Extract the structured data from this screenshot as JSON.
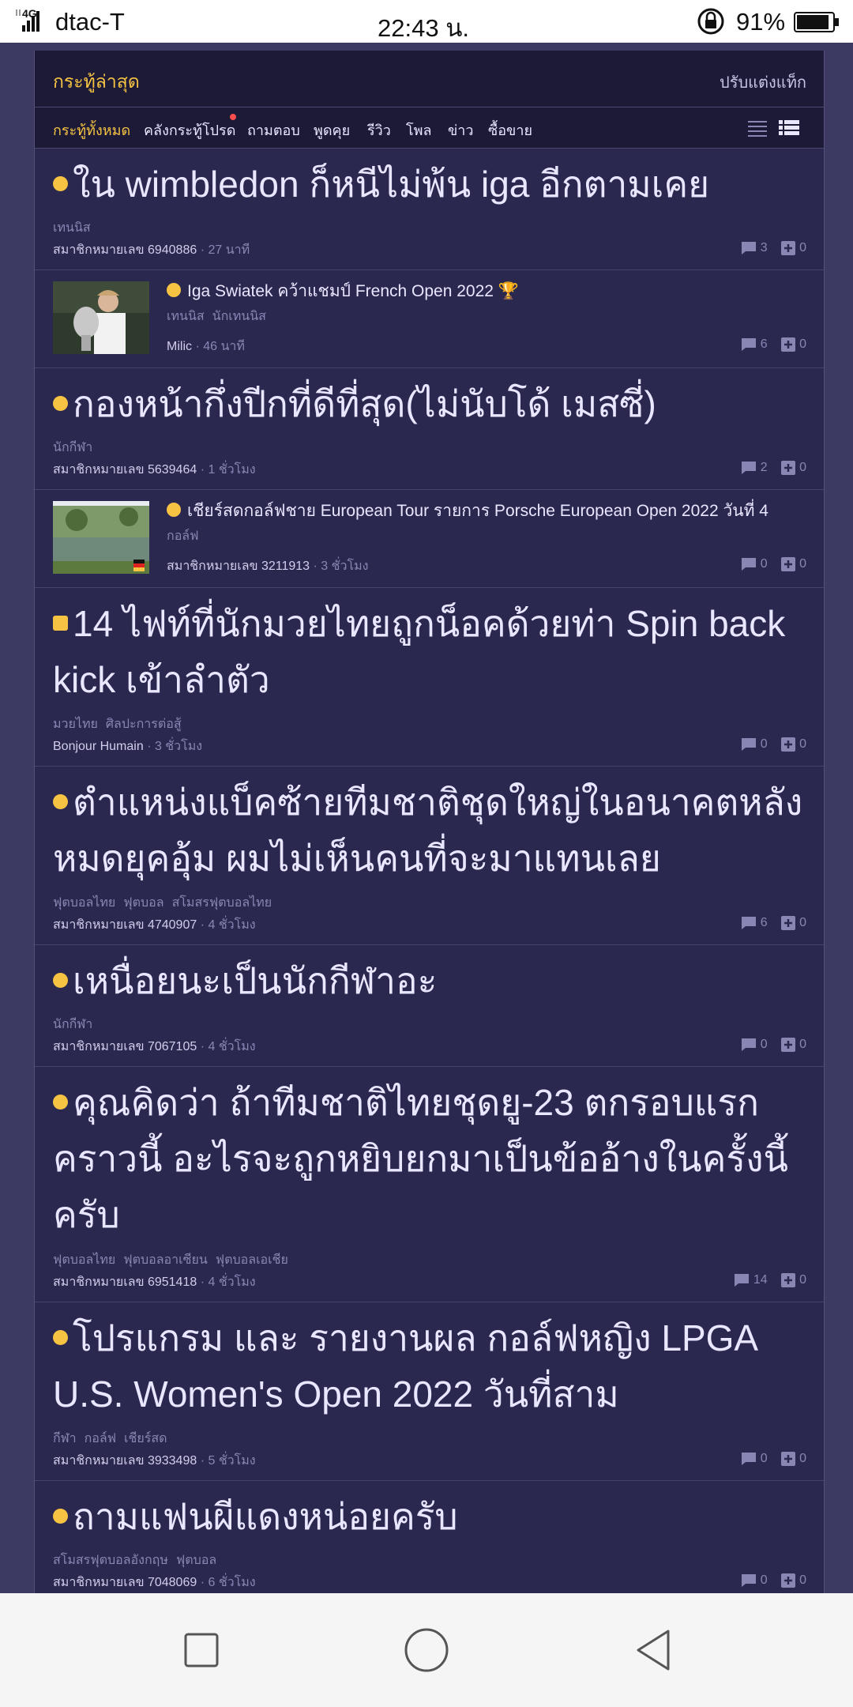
{
  "status": {
    "network": "4G",
    "carrier": "dtac-T",
    "time": "22:43 น.",
    "battery": "91%",
    "battery_level": 0.91
  },
  "header": {
    "title": "กระทู้ล่าสุด",
    "customize": "ปรับแต่งแท็ก"
  },
  "tabs": [
    {
      "label": "กระทู้ทั้งหมด"
    },
    {
      "label": "คลังกระทู้โปรด"
    },
    {
      "label": "ถามตอบ"
    },
    {
      "label": "พูดคุย"
    },
    {
      "label": "รีวิว"
    },
    {
      "label": "โพล"
    },
    {
      "label": "ข่าว"
    },
    {
      "label": "ซื้อขาย"
    }
  ],
  "topics": [
    {
      "title": "ใน wimbledon ก็หนีไม่พ้น iga อีกตามเคย",
      "tags": [
        "เทนนิส"
      ],
      "author": "สมาชิกหมายเลข 6940886",
      "time": "· 27 นาที",
      "comments": "3",
      "votes": "0"
    },
    {
      "title": "Iga Swiatek คว้าแชมป์ French Open 2022 🏆",
      "tags": [
        "เทนนิส",
        "นักเทนนิส"
      ],
      "author": "Milic",
      "time": "· 46 นาที",
      "comments": "6",
      "votes": "0"
    },
    {
      "title": "กองหน้ากึ่งปีกที่ดีที่สุด(ไม่นับโด้ เมสซี่)",
      "tags": [
        "นักกีฬา"
      ],
      "author": "สมาชิกหมายเลข 5639464",
      "time": "· 1 ชั่วโมง",
      "comments": "2",
      "votes": "0"
    },
    {
      "title": "เชียร์สดกอล์ฟชาย European Tour รายการ Porsche European Open 2022 วันที่ 4",
      "tags": [
        "กอล์ฟ"
      ],
      "author": "สมาชิกหมายเลข 3211913",
      "time": "· 3 ชั่วโมง",
      "comments": "0",
      "votes": "0"
    },
    {
      "title": "14 ไฟท์ที่นักมวยไทยถูกน็อคด้วยท่า Spin back kick เข้าลำตัว",
      "tags": [
        "มวยไทย",
        "ศิลปะการต่อสู้"
      ],
      "author": "Bonjour Humain",
      "time": "· 3 ชั่วโมง",
      "comments": "0",
      "votes": "0"
    },
    {
      "title": "ตำแหน่งแบ็คซ้ายทีมชาติชุดใหญ่ในอนาคตหลังหมดยุคอุ้ม ผมไม่เห็นคนที่จะมาแทนเลย",
      "tags": [
        "ฟุตบอลไทย",
        "ฟุตบอล",
        "สโมสรฟุตบอลไทย"
      ],
      "author": "สมาชิกหมายเลข 4740907",
      "time": "· 4 ชั่วโมง",
      "comments": "6",
      "votes": "0"
    },
    {
      "title": "เหนื่อยนะเป็นนักกีฬาอะ",
      "tags": [
        "นักกีฬา"
      ],
      "author": "สมาชิกหมายเลข 7067105",
      "time": "· 4 ชั่วโมง",
      "comments": "0",
      "votes": "0"
    },
    {
      "title": "คุณคิดว่า ถ้าทีมชาติไทยชุดยู-23 ตกรอบแรกคราวนี้ อะไรจะถูกหยิบยกมาเป็นข้ออ้างในครั้งนี้ครับ",
      "tags": [
        "ฟุตบอลไทย",
        "ฟุตบอลอาเซียน",
        "ฟุตบอลเอเชีย"
      ],
      "author": "สมาชิกหมายเลข 6951418",
      "time": "· 4 ชั่วโมง",
      "comments": "14",
      "votes": "0"
    },
    {
      "title": "โปรแกรม และ รายงานผล กอล์ฟหญิง LPGA U.S. Women's Open 2022 วันที่สาม",
      "tags": [
        "กีฬา",
        "กอล์ฟ",
        "เชียร์สด"
      ],
      "author": "สมาชิกหมายเลข 3933498",
      "time": "· 5 ชั่วโมง",
      "comments": "0",
      "votes": "0"
    },
    {
      "title": "ถามแฟนผีแดงหน่อยครับ",
      "tags": [
        "สโมสรฟุตบอลอังกฤษ",
        "ฟุตบอล"
      ],
      "author": "สมาชิกหมายเลข 7048069",
      "time": "· 6 ชั่วโมง",
      "comments": "0",
      "votes": "0"
    }
  ],
  "colors": {
    "background": "#3c3963",
    "panel": "#2b2850",
    "header": "#1c1a36",
    "accent": "#f6c343",
    "text": "#e9e6ff",
    "muted": "#8a86b4"
  },
  "icons": [
    "signal-icon",
    "lock-rotation-icon",
    "battery-icon",
    "list-view-icon",
    "card-view-icon",
    "comment-icon",
    "vote-icon",
    "question-icon",
    "review-icon",
    "news-icon",
    "nav-recent-icon",
    "nav-home-icon",
    "nav-back-icon"
  ]
}
